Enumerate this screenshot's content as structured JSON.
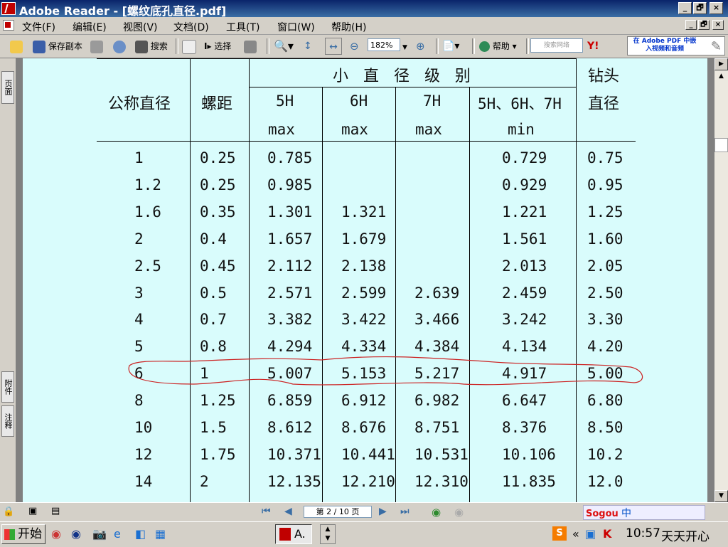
{
  "window": {
    "title": "Adobe Reader - [螺纹底孔直径.pdf]",
    "controls": {
      "minimize": "_",
      "restore": "🗗",
      "close": "×"
    }
  },
  "menu": [
    "文件(F)",
    "编辑(E)",
    "视图(V)",
    "文档(D)",
    "工具(T)",
    "窗口(W)",
    "帮助(H)"
  ],
  "toolbar": {
    "save_copy": "保存副本",
    "search": "搜索",
    "select": "选择",
    "zoom": "182%",
    "help": "帮助",
    "web_search_placeholder": "搜索网络",
    "yahoo": "Y!",
    "ad_text": "在 Adobe PDF 中嵌入视频和音频"
  },
  "side_tabs": [
    "页面",
    "附件",
    "注释"
  ],
  "table": {
    "headers": {
      "nominal": "公称直径",
      "pitch": "螺距",
      "group": "小   直   径   级   别",
      "drill": "钻头",
      "drill2": "直径",
      "grades": [
        "5H",
        "6H",
        "7H",
        "5H、6H、7H"
      ],
      "limits": [
        "max",
        "max",
        "max",
        "min"
      ]
    },
    "rows": [
      [
        "1",
        "0.25",
        "0.785",
        "",
        "",
        "0.729",
        "0.75"
      ],
      [
        "1.2",
        "0.25",
        "0.985",
        "",
        "",
        "0.929",
        "0.95"
      ],
      [
        "1.6",
        "0.35",
        "1.301",
        "1.321",
        "",
        "1.221",
        "1.25"
      ],
      [
        "2",
        "0.4",
        "1.657",
        "1.679",
        "",
        "1.561",
        "1.60"
      ],
      [
        "2.5",
        "0.45",
        "2.112",
        "2.138",
        "",
        "2.013",
        "2.05"
      ],
      [
        "3",
        "0.5",
        "2.571",
        "2.599",
        "2.639",
        "2.459",
        "2.50"
      ],
      [
        "4",
        "0.7",
        "3.382",
        "3.422",
        "3.466",
        "3.242",
        "3.30"
      ],
      [
        "5",
        "0.8",
        "4.294",
        "4.334",
        "4.384",
        "4.134",
        "4.20"
      ],
      [
        "6",
        "1",
        "5.007",
        "5.153",
        "5.217",
        "4.917",
        "5.00"
      ],
      [
        "8",
        "1.25",
        "6.859",
        "6.912",
        "6.982",
        "6.647",
        "6.80"
      ],
      [
        "10",
        "1.5",
        "8.612",
        "8.676",
        "8.751",
        "8.376",
        "8.50"
      ],
      [
        "12",
        "1.75",
        "10.371",
        "10.441",
        "10.531",
        "10.106",
        "10.2"
      ],
      [
        "14",
        "2",
        "12.135",
        "12.210",
        "12.310",
        "11.835",
        "12.0"
      ]
    ]
  },
  "status": {
    "page_indicator": "第 2 / 10 页"
  },
  "taskbar": {
    "start": "开始",
    "task_button": "A.",
    "clock": "10:57",
    "tray_text": "天天开心",
    "ime": "中"
  }
}
